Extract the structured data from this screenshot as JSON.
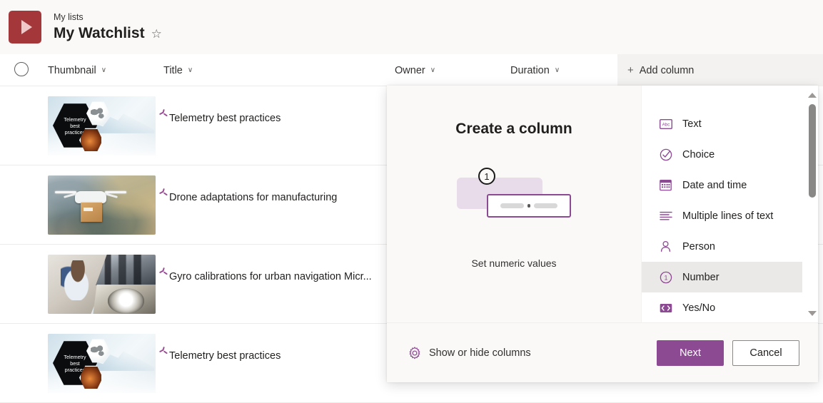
{
  "header": {
    "logo_icon": "play-logo-icon",
    "logo_color": "#a4373a",
    "breadcrumb": "My lists",
    "title": "My Watchlist",
    "favorite_icon": "star-icon",
    "favorite_glyph": "☆"
  },
  "list": {
    "select_all_icon": "select-all-circle-icon",
    "columns": [
      {
        "label": "Thumbnail",
        "has_menu": true
      },
      {
        "label": "Title",
        "has_menu": true
      },
      {
        "label": "Owner",
        "has_menu": true
      },
      {
        "label": "Duration",
        "has_menu": true
      }
    ],
    "add_column_label": "Add column",
    "add_column_plus": "+",
    "chevron_glyph": "∨",
    "rows": [
      {
        "title": "Telemetry best practices",
        "thumbnail": "telemetry",
        "thumb_text": "Telemetry\nbest\npractices",
        "new_badge": "sparkle-icon"
      },
      {
        "title": "Drone adaptations for manufacturing",
        "thumbnail": "drone",
        "new_badge": "sparkle-icon"
      },
      {
        "title": "Gyro calibrations for urban navigation Micr...",
        "thumbnail": "gyro",
        "new_badge": "sparkle-icon"
      },
      {
        "title": "Telemetry best practices",
        "thumbnail": "telemetry",
        "thumb_text": "Telemetry\nbest\npractices",
        "new_badge": "sparkle-icon"
      }
    ]
  },
  "dialog": {
    "title": "Create a column",
    "illustration": {
      "badge_number": "1",
      "caption": "Set numeric values",
      "accent_color": "#8c4a93",
      "panel_color": "#e8dcea"
    },
    "types": [
      {
        "label": "Text",
        "icon": "text-abc-icon",
        "selected": false
      },
      {
        "label": "Choice",
        "icon": "choice-check-circle-icon",
        "selected": false
      },
      {
        "label": "Date and time",
        "icon": "calendar-icon",
        "selected": false
      },
      {
        "label": "Multiple lines of text",
        "icon": "multiline-text-icon",
        "selected": false
      },
      {
        "label": "Person",
        "icon": "person-icon",
        "selected": false
      },
      {
        "label": "Number",
        "icon": "number-one-circle-icon",
        "selected": true
      },
      {
        "label": "Yes/No",
        "icon": "toggle-yes-no-icon",
        "selected": false
      }
    ],
    "scrollbar": {
      "up_icon": "scroll-up-arrow-icon",
      "down_icon": "scroll-down-arrow-icon"
    },
    "footer": {
      "show_hide_label": "Show or hide columns",
      "show_hide_icon": "gear-icon",
      "next_label": "Next",
      "cancel_label": "Cancel",
      "primary_color": "#8c4a93"
    }
  }
}
